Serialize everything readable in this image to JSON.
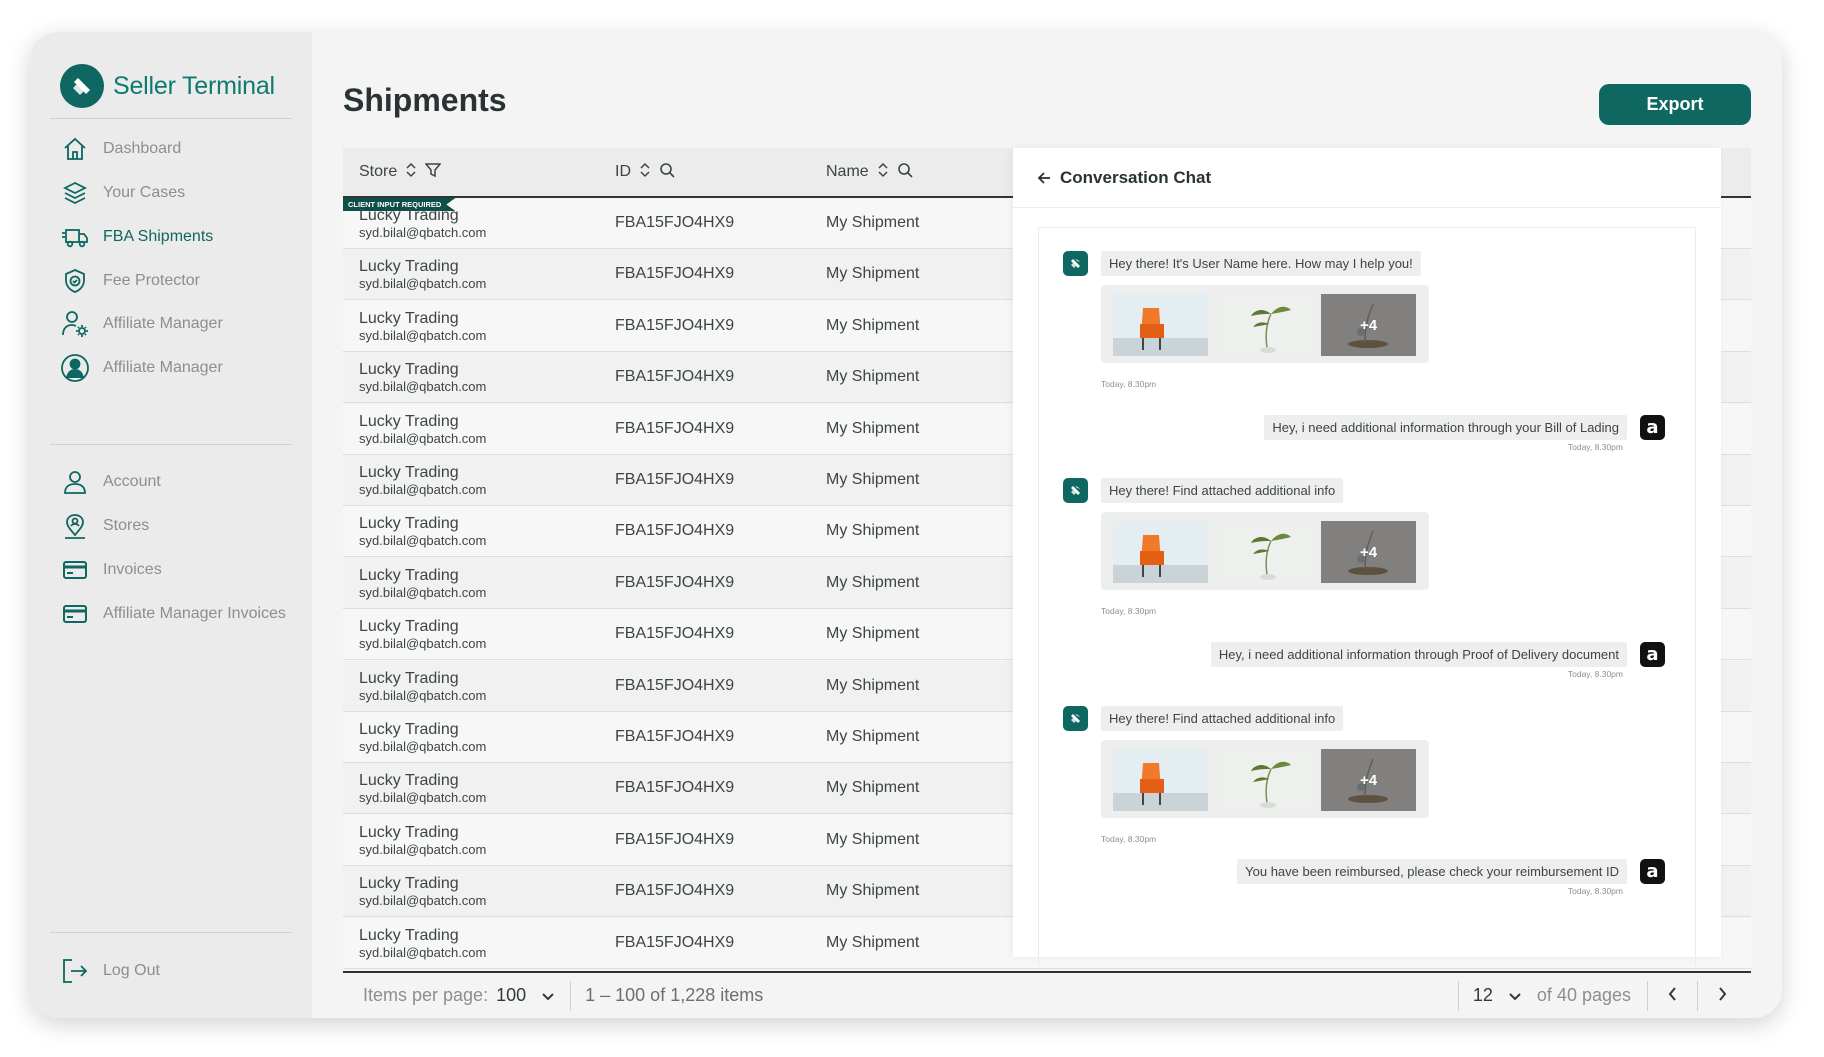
{
  "app": {
    "name": "Seller Terminal",
    "brand_color": "#0e6760"
  },
  "sidebar": {
    "items": [
      {
        "label": "Dashboard",
        "icon": "home-icon"
      },
      {
        "label": "Your Cases",
        "icon": "layers-icon"
      },
      {
        "label": "FBA Shipments",
        "icon": "truck-icon",
        "active": true
      },
      {
        "label": "Fee Protector",
        "icon": "shield-icon"
      },
      {
        "label": "Affiliate Manager",
        "icon": "user-gear-icon"
      },
      {
        "label": "Affiliate Manager",
        "icon": "user-circle-icon"
      }
    ],
    "items2": [
      {
        "label": "Account",
        "icon": "user-icon"
      },
      {
        "label": "Stores",
        "icon": "location-user-icon"
      },
      {
        "label": "Invoices",
        "icon": "card-icon"
      },
      {
        "label": "Affiliate Manager Invoices",
        "icon": "card-icon"
      }
    ],
    "logout": {
      "label": "Log Out",
      "icon": "logout-icon"
    }
  },
  "page": {
    "title": "Shipments",
    "export_label": "Export"
  },
  "table": {
    "columns": [
      {
        "label": "Store"
      },
      {
        "label": "ID"
      },
      {
        "label": "Name"
      }
    ],
    "badge": "CLIENT INPUT REQUIRED",
    "rows": [
      {
        "store": "Lucky Trading",
        "email": "syd.bilal@qbatch.com",
        "id": "FBA15FJO4HX9",
        "name": "My Shipment"
      },
      {
        "store": "Lucky Trading",
        "email": "syd.bilal@qbatch.com",
        "id": "FBA15FJO4HX9",
        "name": "My Shipment"
      },
      {
        "store": "Lucky Trading",
        "email": "syd.bilal@qbatch.com",
        "id": "FBA15FJO4HX9",
        "name": "My Shipment"
      },
      {
        "store": "Lucky Trading",
        "email": "syd.bilal@qbatch.com",
        "id": "FBA15FJO4HX9",
        "name": "My Shipment"
      },
      {
        "store": "Lucky Trading",
        "email": "syd.bilal@qbatch.com",
        "id": "FBA15FJO4HX9",
        "name": "My Shipment"
      },
      {
        "store": "Lucky Trading",
        "email": "syd.bilal@qbatch.com",
        "id": "FBA15FJO4HX9",
        "name": "My Shipment"
      },
      {
        "store": "Lucky Trading",
        "email": "syd.bilal@qbatch.com",
        "id": "FBA15FJO4HX9",
        "name": "My Shipment"
      },
      {
        "store": "Lucky Trading",
        "email": "syd.bilal@qbatch.com",
        "id": "FBA15FJO4HX9",
        "name": "My Shipment"
      },
      {
        "store": "Lucky Trading",
        "email": "syd.bilal@qbatch.com",
        "id": "FBA15FJO4HX9",
        "name": "My Shipment"
      },
      {
        "store": "Lucky Trading",
        "email": "syd.bilal@qbatch.com",
        "id": "FBA15FJO4HX9",
        "name": "My Shipment"
      },
      {
        "store": "Lucky Trading",
        "email": "syd.bilal@qbatch.com",
        "id": "FBA15FJO4HX9",
        "name": "My Shipment"
      },
      {
        "store": "Lucky Trading",
        "email": "syd.bilal@qbatch.com",
        "id": "FBA15FJO4HX9",
        "name": "My Shipment"
      },
      {
        "store": "Lucky Trading",
        "email": "syd.bilal@qbatch.com",
        "id": "FBA15FJO4HX9",
        "name": "My Shipment"
      },
      {
        "store": "Lucky Trading",
        "email": "syd.bilal@qbatch.com",
        "id": "FBA15FJO4HX9",
        "name": "My Shipment"
      },
      {
        "store": "Lucky Trading",
        "email": "syd.bilal@qbatch.com",
        "id": "FBA15FJO4HX9",
        "name": "My Shipment"
      }
    ]
  },
  "pagination": {
    "items_per_page_label": "Items per page:",
    "items_per_page": "100",
    "range": "1 – 100 of 1,228 items",
    "current_page": "12",
    "of_pages": "of 40 pages"
  },
  "chat": {
    "title": "Conversation Chat",
    "more_label": "+4",
    "messages": [
      {
        "from": "bot",
        "text": "Hey there! It's User Name here. How may I help you!",
        "time": "Today, 8.30pm",
        "gallery": true
      },
      {
        "from": "amazon",
        "avatar": "a",
        "text": "Hey, i need additional information through your Bill of Lading",
        "time": "Today, 8.30pm"
      },
      {
        "from": "bot",
        "text": "Hey there! Find attached additional info",
        "time": "Today, 8.30pm",
        "gallery": true
      },
      {
        "from": "amazon",
        "avatar": "a",
        "text": "Hey, i need additional information through Proof of Delivery document",
        "time": "Today, 8.30pm"
      },
      {
        "from": "bot",
        "text": "Hey there! Find attached additional info",
        "time": "Today, 8.30pm",
        "gallery": true
      },
      {
        "from": "amazon",
        "avatar": "a",
        "text": "You have been reimbursed, please check your  reimbursement ID",
        "time": "Today, 8.30pm"
      }
    ]
  }
}
